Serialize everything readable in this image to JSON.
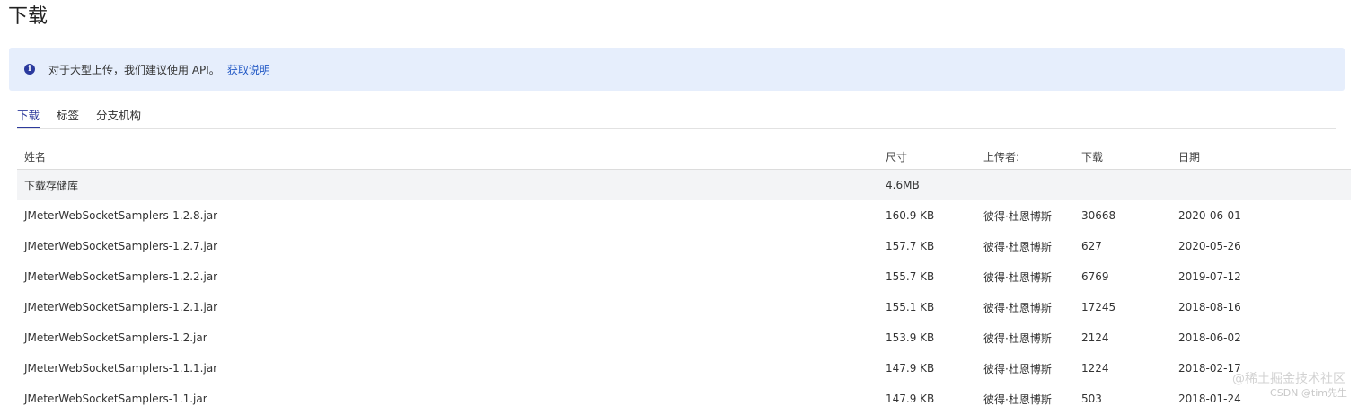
{
  "header": {
    "title": "下载"
  },
  "notice": {
    "text": "对于大型上传，我们建议使用 API。",
    "link": "获取说明"
  },
  "tabs": [
    "下载",
    "标签",
    "分支机构"
  ],
  "table": {
    "columns": [
      "姓名",
      "尺寸",
      "上传者:",
      "下载",
      "日期"
    ],
    "repo_row": {
      "name": "下载存储库",
      "size": "4.6MB"
    },
    "rows": [
      {
        "name": "JMeterWebSocketSamplers-1.2.8.jar",
        "size": "160.9 KB",
        "uploader": "彼得·杜恩博斯",
        "downloads": "30668",
        "date": "2020-06-01"
      },
      {
        "name": "JMeterWebSocketSamplers-1.2.7.jar",
        "size": "157.7 KB",
        "uploader": "彼得·杜恩博斯",
        "downloads": "627",
        "date": "2020-05-26"
      },
      {
        "name": "JMeterWebSocketSamplers-1.2.2.jar",
        "size": "155.7 KB",
        "uploader": "彼得·杜恩博斯",
        "downloads": "6769",
        "date": "2019-07-12"
      },
      {
        "name": "JMeterWebSocketSamplers-1.2.1.jar",
        "size": "155.1 KB",
        "uploader": "彼得·杜恩博斯",
        "downloads": "17245",
        "date": "2018-08-16"
      },
      {
        "name": "JMeterWebSocketSamplers-1.2.jar",
        "size": "153.9 KB",
        "uploader": "彼得·杜恩博斯",
        "downloads": "2124",
        "date": "2018-06-02"
      },
      {
        "name": "JMeterWebSocketSamplers-1.1.1.jar",
        "size": "147.9 KB",
        "uploader": "彼得·杜恩博斯",
        "downloads": "1224",
        "date": "2018-02-17"
      },
      {
        "name": "JMeterWebSocketSamplers-1.1.jar",
        "size": "147.9 KB",
        "uploader": "彼得·杜恩博斯",
        "downloads": "503",
        "date": "2018-01-24"
      }
    ]
  },
  "watermark": {
    "line1": "@稀土掘金技术社区",
    "line2": "CSDN @tim先生"
  },
  "colors": {
    "accent": "#2d3a9c",
    "notice_bg": "#e6eefc",
    "link": "#1f56c4"
  },
  "icons": {
    "notice": "info-icon"
  }
}
